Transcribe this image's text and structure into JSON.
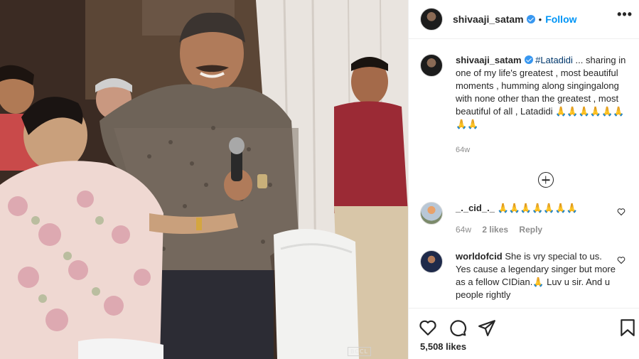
{
  "post": {
    "watermark": "BCCL"
  },
  "header": {
    "username": "shivaaji_satam",
    "separator": "•",
    "follow_label": "Follow",
    "more_label": "•••"
  },
  "caption": {
    "username": "shivaaji_satam",
    "hashtag": "#Latadidi",
    "text": " ... sharing in one of my life's greatest , most beautiful moments , humming along singingalong with none other than the greatest , most beautiful of all , Latadidi 🙏🙏🙏🙏🙏🙏🙏🙏",
    "time": "64w"
  },
  "comments": [
    {
      "username": "_._cid_._",
      "text": " 🙏🙏🙏🙏🙏🙏🙏",
      "time": "64w",
      "likes": "2 likes",
      "reply_label": "Reply"
    },
    {
      "username": "worldofcid",
      "text": " She is vry special to us. Yes cause a legendary singer but more as a fellow CIDian.🙏 Luv u sir. And u people rightly"
    }
  ],
  "actions": {
    "like_icon": "heart-icon",
    "comment_icon": "comment-icon",
    "share_icon": "share-icon",
    "save_icon": "bookmark-icon"
  },
  "likes_count": "5,508 likes",
  "colors": {
    "link_blue": "#0095f6",
    "hashtag": "#00376b",
    "secondary": "#8e8e8e",
    "text": "#262626",
    "verified": "#3897f0"
  }
}
